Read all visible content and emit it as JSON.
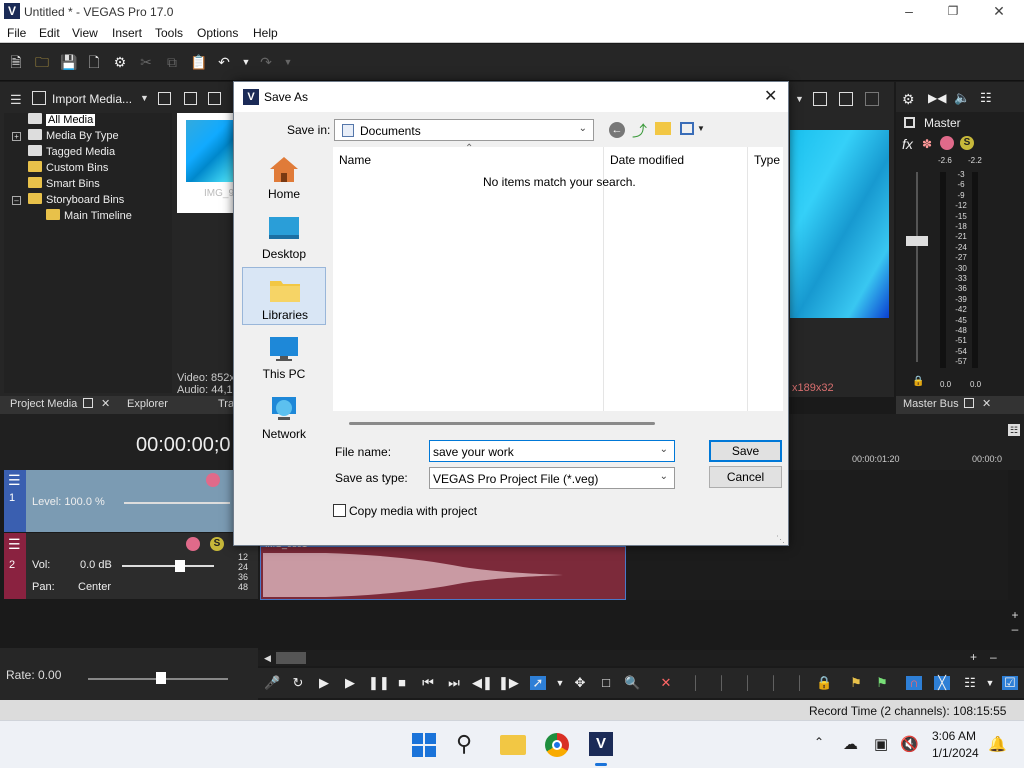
{
  "window": {
    "title": "Untitled * - VEGAS Pro 17.0",
    "app_icon_letter": "V"
  },
  "menu": [
    "File",
    "Edit",
    "View",
    "Insert",
    "Tools",
    "Options",
    "Help"
  ],
  "media_toolbar": {
    "import_label": "Import Media..."
  },
  "tree": {
    "items": [
      {
        "label": "All Media",
        "selected": true
      },
      {
        "label": "Media By Type"
      },
      {
        "label": "Tagged Media"
      },
      {
        "label": "Custom Bins"
      },
      {
        "label": "Smart Bins"
      },
      {
        "label": "Storyboard Bins"
      },
      {
        "label": "Main Timeline"
      }
    ]
  },
  "thumb_caption": "IMG_9",
  "media_info": {
    "video": "Video: 852x",
    "audio": "Audio: 44,1"
  },
  "preview_info": "x189x32",
  "tabs": {
    "project_media": "Project Media",
    "explorer": "Explorer",
    "tra": "Tra",
    "master_bus": "Master Bus"
  },
  "master": {
    "label": "Master",
    "fx": "fx",
    "peak_left": "-2.6",
    "peak_right": "-2.2",
    "scale": [
      "3",
      "6",
      "9",
      "12",
      "15",
      "18",
      "21",
      "24",
      "27",
      "30",
      "33",
      "36",
      "39",
      "42",
      "45",
      "48",
      "51",
      "54",
      "57"
    ],
    "bottom_left": "0.0",
    "bottom_right": "0.0"
  },
  "timeline": {
    "timecode": "00:00:00;0",
    "ruler": [
      "00:00:01:20",
      "00:00:0"
    ],
    "track1": {
      "number": "1",
      "level": "Level: 100.0 %"
    },
    "track2": {
      "number": "2",
      "vol_label": "Vol:",
      "vol_value": "0.0 dB",
      "pan_label": "Pan:",
      "pan_value": "Center"
    },
    "clip_label": "IMG_9591",
    "db_scale": [
      "12",
      "24",
      "36",
      "48"
    ],
    "rate": "Rate: 0.00"
  },
  "status": {
    "record_time": "Record Time (2 channels): 108:15:55"
  },
  "taskbar": {
    "time": "3:06 AM",
    "date": "1/1/2024"
  },
  "dialog": {
    "title": "Save As",
    "save_in_label": "Save in:",
    "save_in_value": "Documents",
    "places": [
      "Home",
      "Desktop",
      "Libraries",
      "This PC",
      "Network"
    ],
    "selected_place": "Libraries",
    "columns": [
      "Name",
      "Date modified",
      "Type"
    ],
    "empty_message": "No items match your search.",
    "file_name_label": "File name:",
    "file_name_value": "save your work",
    "save_type_label": "Save as type:",
    "save_type_value": "VEGAS Pro Project File (*.veg)",
    "save_button": "Save",
    "cancel_button": "Cancel",
    "copy_media_label": "Copy media with project",
    "copy_media_checked": false
  }
}
